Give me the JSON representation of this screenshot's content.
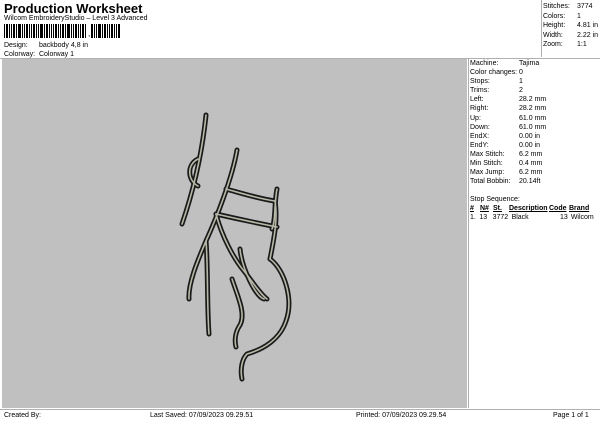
{
  "header": {
    "title": "Production Worksheet",
    "subtitle": "Wilcom EmbroideryStudio – Level 3 Advanced",
    "design_label": "Design:",
    "design_value": "backbody 4,8 in",
    "colorway_label": "Colorway:",
    "colorway_value": "Colorway 1"
  },
  "stats": [
    {
      "k": "Stitches:",
      "v": "3774"
    },
    {
      "k": "Colors:",
      "v": "1"
    },
    {
      "k": "Height:",
      "v": "4.81 in"
    },
    {
      "k": "Width:",
      "v": "2.22 in"
    },
    {
      "k": "Zoom:",
      "v": "1:1"
    }
  ],
  "machine": [
    {
      "k": "Machine:",
      "v": "Tajima"
    },
    {
      "k": "Color changes:",
      "v": "0"
    },
    {
      "k": "Stops:",
      "v": "1"
    },
    {
      "k": "Trims:",
      "v": "2"
    },
    {
      "k": "Left:",
      "v": "28.2 mm"
    },
    {
      "k": "Right:",
      "v": "28.2 mm"
    },
    {
      "k": "Up:",
      "v": "61.0 mm"
    },
    {
      "k": "Down:",
      "v": "61.0 mm"
    },
    {
      "k": "EndX:",
      "v": "0.00 in"
    },
    {
      "k": "EndY:",
      "v": "0.00 in"
    },
    {
      "k": "Max Stitch:",
      "v": "6.2 mm"
    },
    {
      "k": "Min Stitch:",
      "v": "0.4 mm"
    },
    {
      "k": "Max Jump:",
      "v": "6.2 mm"
    },
    {
      "k": "Total Bobbin:",
      "v": "20.14ft"
    }
  ],
  "stop_sequence": {
    "title": "Stop Sequence:",
    "headers": [
      "#",
      "N#",
      "St.",
      "Description",
      "Code",
      "Brand"
    ],
    "rows": [
      {
        "idx": "1.",
        "n": "13",
        "st": "3772",
        "desc": "Black",
        "code": "13",
        "brand": "Wilcom",
        "color": "#2b2b2b"
      }
    ]
  },
  "footer": {
    "created_by": "Created By:",
    "last_saved": "Last Saved: 07/09/2023 09.29.51",
    "printed": "Printed: 07/09/2023 09.29.54",
    "page": "Page 1 of 1"
  },
  "colors": {
    "canvas_bg": "#c0c0c0",
    "thread": "#2b2b2b"
  }
}
